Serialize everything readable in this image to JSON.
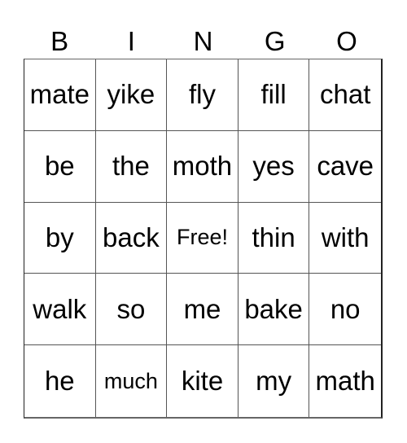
{
  "header": {
    "letters": [
      "B",
      "I",
      "N",
      "G",
      "O"
    ]
  },
  "card": {
    "rows": [
      [
        "mate",
        "yike",
        "fly",
        "fill",
        "chat"
      ],
      [
        "be",
        "the",
        "moth",
        "yes",
        "cave"
      ],
      [
        "by",
        "back",
        "Free!",
        "thin",
        "with"
      ],
      [
        "walk",
        "so",
        "me",
        "bake",
        "no"
      ],
      [
        "he",
        "much",
        "kite",
        "my",
        "math"
      ]
    ]
  }
}
